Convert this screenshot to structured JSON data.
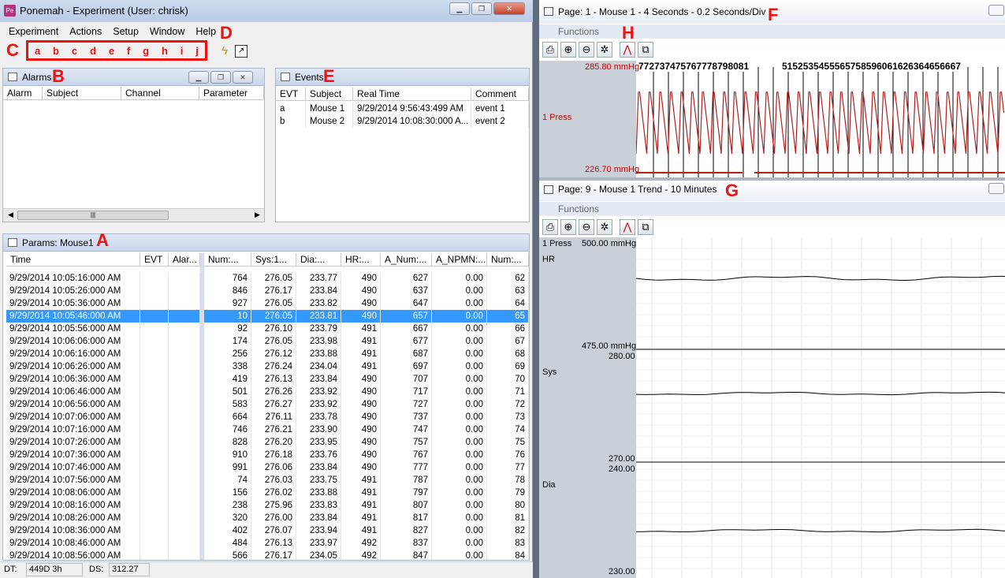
{
  "main_window": {
    "title": "Ponemah - Experiment (User: chrisk)",
    "menu": [
      "Experiment",
      "Actions",
      "Setup",
      "Window",
      "Help"
    ],
    "letters": [
      "a",
      "b",
      "c",
      "d",
      "e",
      "f",
      "g",
      "h",
      "i",
      "j"
    ]
  },
  "annotations": {
    "A": "A",
    "B": "B",
    "C": "C",
    "D": "D",
    "E": "E",
    "F": "F",
    "G": "G",
    "H": "H"
  },
  "alarms": {
    "title": "Alarms",
    "columns": [
      "Alarm",
      "Subject",
      "Channel",
      "Parameter"
    ]
  },
  "events": {
    "title": "Events",
    "columns": [
      "EVT",
      "Subject",
      "Real Time",
      "Comment"
    ],
    "rows": [
      [
        "a",
        "Mouse 1",
        "9/29/2014 9:56:43:499 AM",
        "event 1"
      ],
      [
        "b",
        "Mouse 2",
        "9/29/2014 10:08:30:000 A...",
        "event 2"
      ]
    ]
  },
  "params": {
    "title": "Params: Mouse1",
    "left_columns": [
      "Time",
      "EVT",
      "Alar..."
    ],
    "right_columns": [
      "Num:...",
      "Sys:1...",
      "Dia:...",
      "HR:...",
      "A_Num:...",
      "A_NPMN:...",
      "Num:..."
    ],
    "rows": [
      [
        "9/29/2014 10:05:16:000 AM",
        "764",
        "276.05",
        "233.77",
        "490",
        "627",
        "0.00",
        "62"
      ],
      [
        "9/29/2014 10:05:26:000 AM",
        "846",
        "276.17",
        "233.84",
        "490",
        "637",
        "0.00",
        "63"
      ],
      [
        "9/29/2014 10:05:36:000 AM",
        "927",
        "276.05",
        "233.82",
        "490",
        "647",
        "0.00",
        "64"
      ],
      [
        "9/29/2014 10:05:46:000 AM",
        "10",
        "276.05",
        "233.81",
        "490",
        "657",
        "0.00",
        "65"
      ],
      [
        "9/29/2014 10:05:56:000 AM",
        "92",
        "276.10",
        "233.79",
        "491",
        "667",
        "0.00",
        "66"
      ],
      [
        "9/29/2014 10:06:06:000 AM",
        "174",
        "276.05",
        "233.98",
        "491",
        "677",
        "0.00",
        "67"
      ],
      [
        "9/29/2014 10:06:16:000 AM",
        "256",
        "276.12",
        "233.88",
        "491",
        "687",
        "0.00",
        "68"
      ],
      [
        "9/29/2014 10:06:26:000 AM",
        "338",
        "276.24",
        "234.04",
        "491",
        "697",
        "0.00",
        "69"
      ],
      [
        "9/29/2014 10:06:36:000 AM",
        "419",
        "276.13",
        "233.84",
        "490",
        "707",
        "0.00",
        "70"
      ],
      [
        "9/29/2014 10:06:46:000 AM",
        "501",
        "276.26",
        "233.92",
        "490",
        "717",
        "0.00",
        "71"
      ],
      [
        "9/29/2014 10:06:56:000 AM",
        "583",
        "276.27",
        "233.92",
        "490",
        "727",
        "0.00",
        "72"
      ],
      [
        "9/29/2014 10:07:06:000 AM",
        "664",
        "276.11",
        "233.78",
        "490",
        "737",
        "0.00",
        "73"
      ],
      [
        "9/29/2014 10:07:16:000 AM",
        "746",
        "276.21",
        "233.90",
        "490",
        "747",
        "0.00",
        "74"
      ],
      [
        "9/29/2014 10:07:26:000 AM",
        "828",
        "276.20",
        "233.95",
        "490",
        "757",
        "0.00",
        "75"
      ],
      [
        "9/29/2014 10:07:36:000 AM",
        "910",
        "276.18",
        "233.76",
        "490",
        "767",
        "0.00",
        "76"
      ],
      [
        "9/29/2014 10:07:46:000 AM",
        "991",
        "276.06",
        "233.84",
        "490",
        "777",
        "0.00",
        "77"
      ],
      [
        "9/29/2014 10:07:56:000 AM",
        "74",
        "276.03",
        "233.75",
        "491",
        "787",
        "0.00",
        "78"
      ],
      [
        "9/29/2014 10:08:06:000 AM",
        "156",
        "276.02",
        "233.88",
        "491",
        "797",
        "0.00",
        "79"
      ],
      [
        "9/29/2014 10:08:16:000 AM",
        "238",
        "275.96",
        "233.83",
        "491",
        "807",
        "0.00",
        "80"
      ],
      [
        "9/29/2014 10:08:26:000 AM",
        "320",
        "276.00",
        "233.84",
        "491",
        "817",
        "0.00",
        "81"
      ],
      [
        "9/29/2014 10:08:36:000 AM",
        "402",
        "276.07",
        "233.94",
        "491",
        "827",
        "0.00",
        "82"
      ],
      [
        "9/29/2014 10:08:46:000 AM",
        "484",
        "276.13",
        "233.97",
        "492",
        "837",
        "0.00",
        "83"
      ],
      [
        "9/29/2014 10:08:56:000 AM",
        "566",
        "276.17",
        "234.05",
        "492",
        "847",
        "0.00",
        "84"
      ]
    ],
    "selected_index": 3
  },
  "status": {
    "dt_label": "DT:",
    "dt_value": "449D 3h",
    "ds_label": "DS:",
    "ds_value": "312.27 GB"
  },
  "page1": {
    "title": "Page: 1 - Mouse 1 - 4 Seconds - 0.2 Seconds/Div",
    "functions": "Functions",
    "channel": "1  Press",
    "ymax": "285.80 mmHg",
    "ymin": "226.70 mmHg",
    "counter_labels": "772737475767778798081",
    "counter_labels2": "5152535455565758596061626364656667"
  },
  "page9": {
    "title": "Page: 9 - Mouse 1 Trend - 10 Minutes",
    "functions": "Functions",
    "channel": "1  Press",
    "hr_label": "HR",
    "hr_top": "500.00 mmHg",
    "hr_bottom": "475.00 mmHg",
    "sys_label": "Sys",
    "sys_top": "280.00",
    "sys_bottom": "270.00",
    "dia_label": "Dia",
    "dia_top": "240.00",
    "dia_bottom": "230.00"
  },
  "icons": [
    "print-icon",
    "zoom-in-icon",
    "zoom-out-icon",
    "autoscale-icon",
    "waveform-icon",
    "copy-icon",
    "lightning-icon",
    "chart-export-icon"
  ]
}
